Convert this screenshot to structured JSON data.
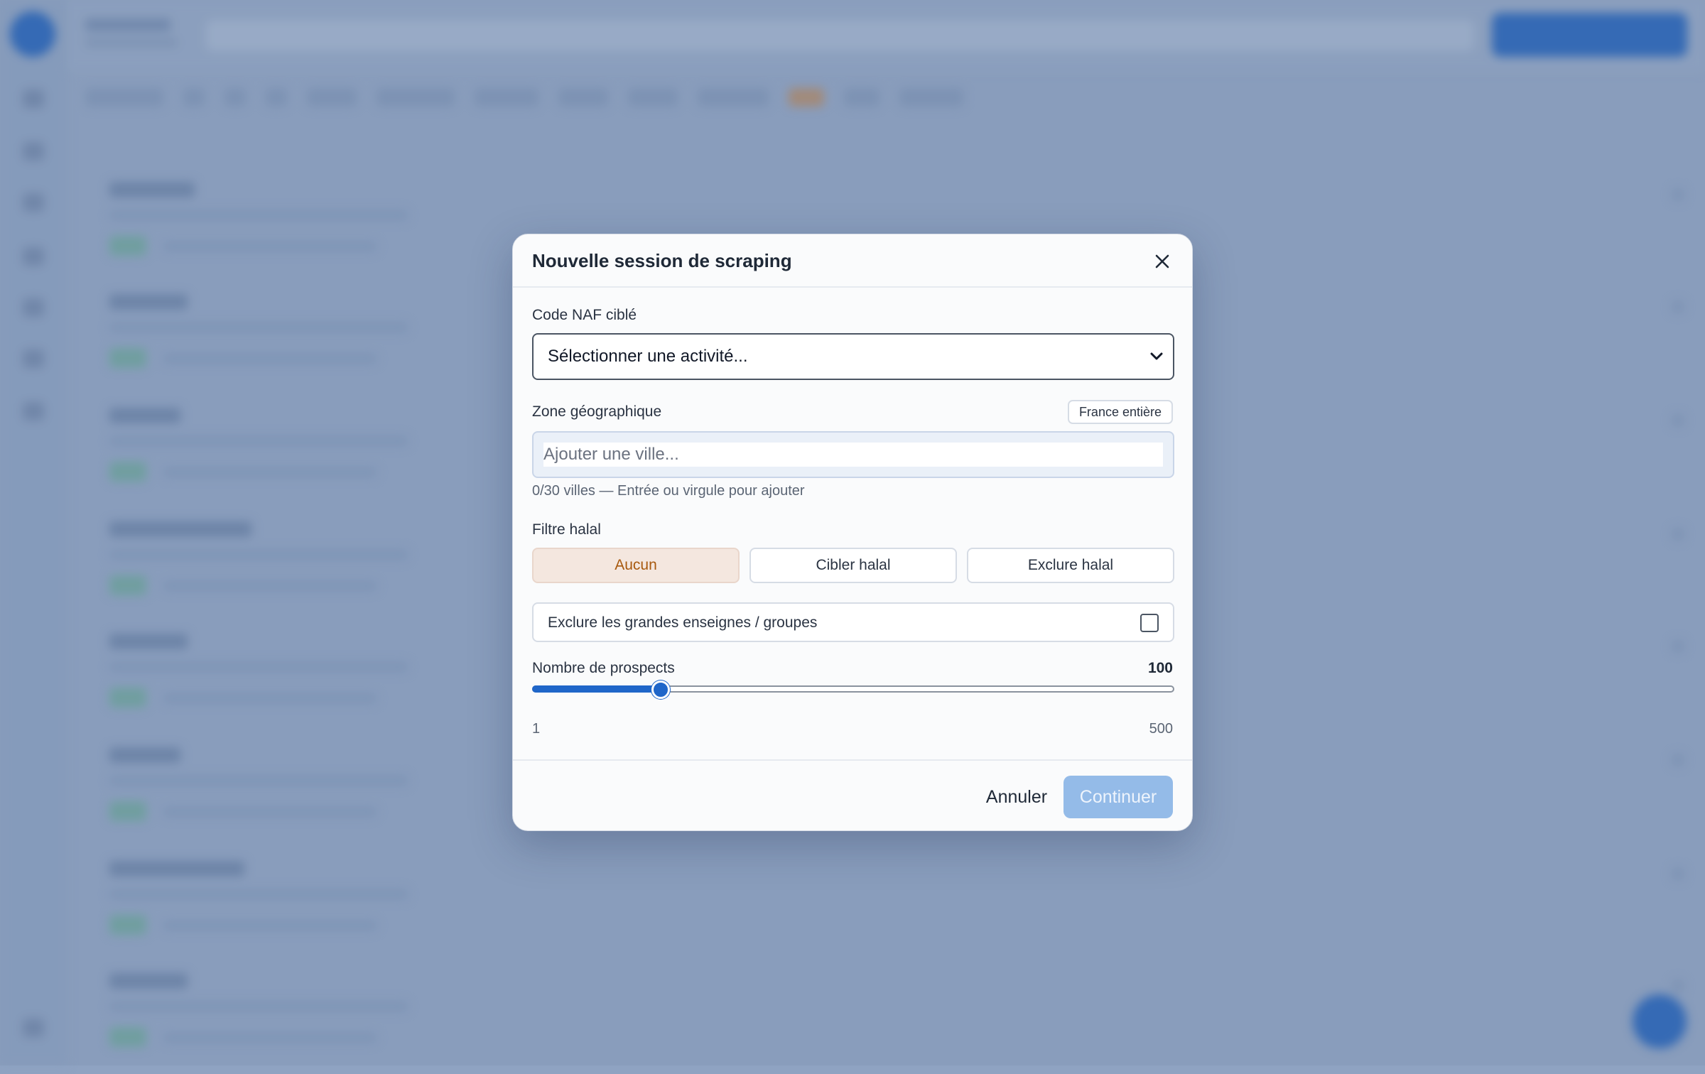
{
  "modal": {
    "title": "Nouvelle session de scraping",
    "naf": {
      "label": "Code NAF ciblé",
      "selected": "Sélectionner une activité..."
    },
    "zone": {
      "label": "Zone géographique",
      "badge": "France entière",
      "placeholder": "Ajouter une ville...",
      "hint": "0/30 villes — Entrée ou virgule pour ajouter"
    },
    "halal": {
      "label": "Filtre halal",
      "options": [
        "Aucun",
        "Cibler halal",
        "Exclure halal"
      ],
      "selected": "Aucun"
    },
    "exclude_chains": {
      "label": "Exclure les grandes enseignes / groupes",
      "checked": false
    },
    "prospects": {
      "label": "Nombre de prospects",
      "value": "100",
      "min": "1",
      "max": "500",
      "fraction": 0.2
    },
    "footer": {
      "cancel": "Annuler",
      "continue": "Continuer"
    }
  },
  "colors": {
    "accent": "#1f66c9",
    "selected_segment_bg": "#f4e7df",
    "selected_segment_text": "#a8590e",
    "disabled_primary": "#94bbe8"
  }
}
